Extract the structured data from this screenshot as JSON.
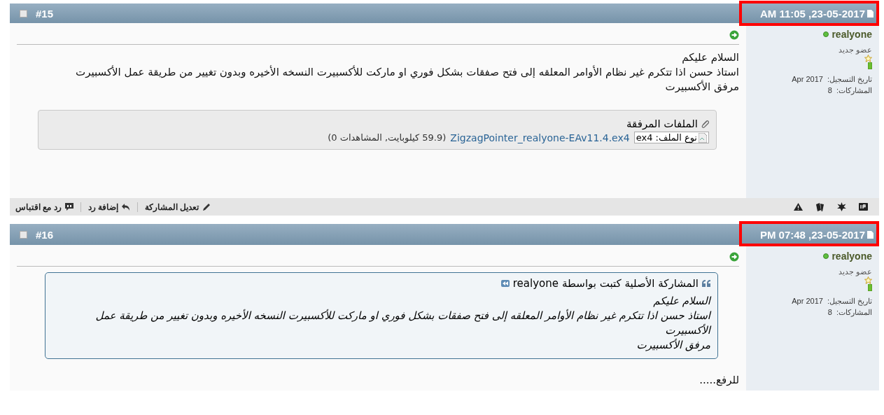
{
  "posts": [
    {
      "number": "#15",
      "checked": false,
      "date": "23-05-2017, 11:05 AM",
      "highlighted": true,
      "user": {
        "name": "realyone",
        "online": true,
        "title": "عضو جديد",
        "joined_label": "تاريخ التسجيل:",
        "joined": "Apr 2017",
        "posts_label": "المشاركات:",
        "posts": "8"
      },
      "message": [
        "السلام عليكم",
        "استاذ حسن اذا تتكرم غير نظام الأوامر المعلقه إلى فتح صفقات بشكل فوري او ماركت للأكسبيرت النسخه الأخيره وبدون تغيير من طريقة عمل الأكسبيرت",
        "مرفق الأكسبيرت"
      ],
      "attachments": {
        "title": "الملفات المرفقة",
        "files": [
          {
            "type_label": "نوع الملف: ex4",
            "name": "ZigzagPointer_realyone-EAv11.4.ex4",
            "info": "(59.9 كيلوبايت, المشاهدات 0)"
          }
        ]
      },
      "actions": [
        {
          "label": "تعديل المشاركة",
          "kind": "edit"
        },
        {
          "label": "إضافة رد",
          "kind": "reply"
        },
        {
          "label": "رد مع اقتباس",
          "kind": "quote"
        }
      ],
      "tools": [
        {
          "kind": "ip"
        },
        {
          "kind": "burst"
        },
        {
          "kind": "cards"
        },
        {
          "kind": "warning"
        }
      ]
    },
    {
      "number": "#16",
      "checked": false,
      "date": "23-05-2017, 07:48 PM",
      "highlighted": true,
      "user": {
        "name": "realyone",
        "online": true,
        "title": "عضو جديد",
        "joined_label": "تاريخ التسجيل:",
        "joined": "Apr 2017",
        "posts_label": "المشاركات:",
        "posts": "8"
      },
      "quote": {
        "heading": "المشاركة الأصلية كتبت بواسطة",
        "author": "realyone",
        "lines": [
          "السلام عليكم",
          "استاذ حسن اذا تتكرم غير نظام الأوامر المعلقه إلى فتح صفقات بشكل فوري او ماركت للأكسبيرت النسخه الأخيره وبدون تغيير من طريقة عمل الأكسبيرت",
          "مرفق الأكسبيرت"
        ]
      },
      "message": [
        "للرفع....."
      ]
    }
  ]
}
